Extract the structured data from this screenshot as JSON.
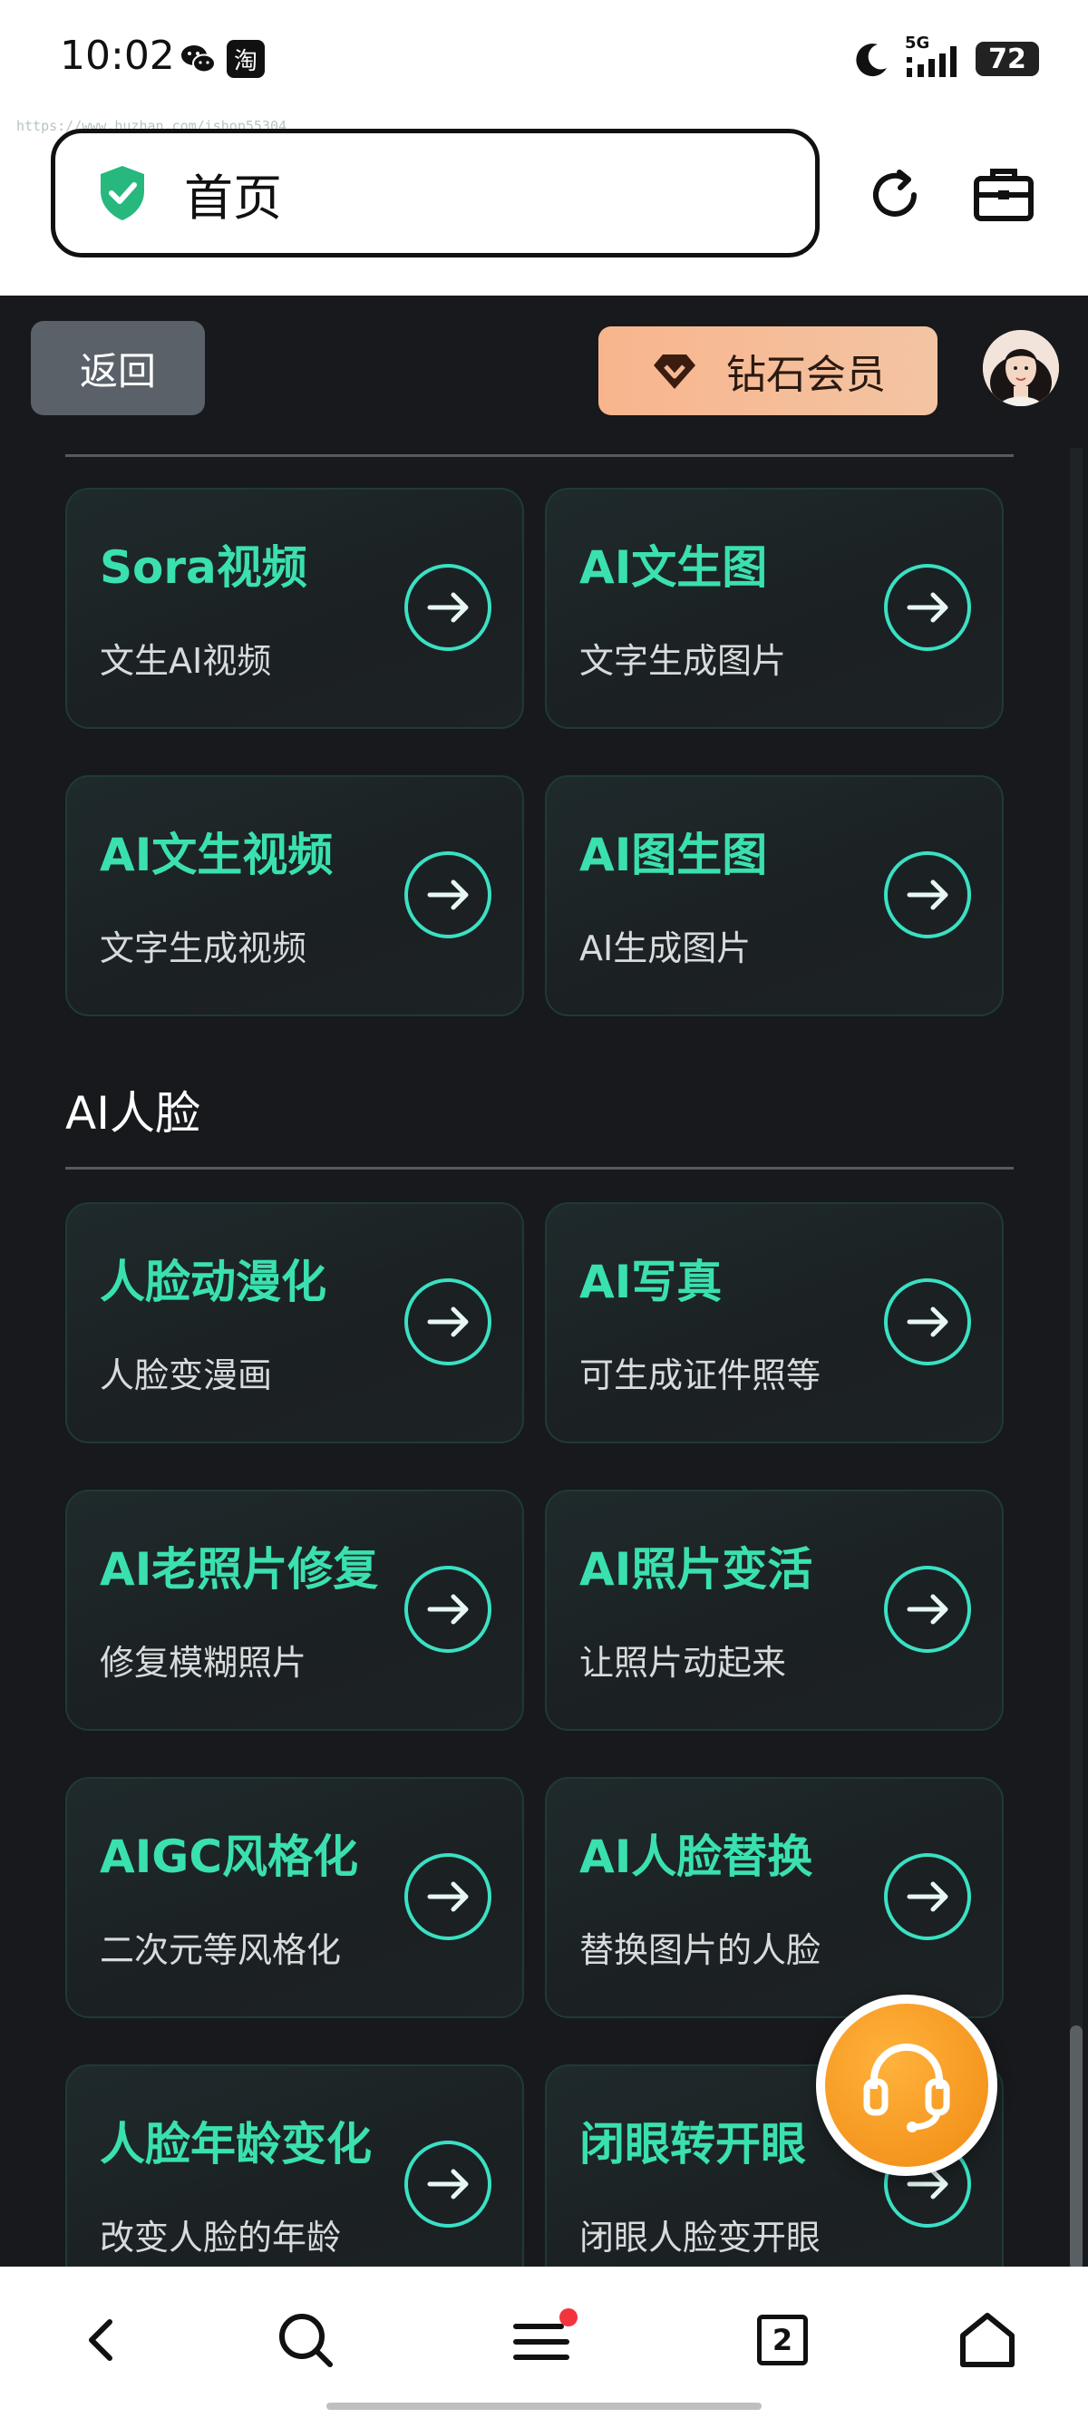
{
  "status_bar": {
    "time": "10:02",
    "wechat_icon": "wechat-icon",
    "taobao_label": "淘",
    "network": "5G",
    "battery": "72"
  },
  "watermark_url": "https://www.huzhan.com/ishop55304",
  "address_bar": {
    "title": "首页",
    "secure_icon": "shield-check-icon"
  },
  "header": {
    "back_label": "返回",
    "vip_label": "钻石会员"
  },
  "sections": [
    {
      "title": "",
      "cards": [
        {
          "title": "Sora视频",
          "subtitle": "文生AI视频"
        },
        {
          "title": "AI文生图",
          "subtitle": "文字生成图片"
        },
        {
          "title": "AI文生视频",
          "subtitle": "文字生成视频"
        },
        {
          "title": "AI图生图",
          "subtitle": "AI生成图片"
        }
      ]
    },
    {
      "title": "AI人脸",
      "cards": [
        {
          "title": "人脸动漫化",
          "subtitle": "人脸变漫画"
        },
        {
          "title": "AI写真",
          "subtitle": "可生成证件照等"
        },
        {
          "title": "AI老照片修复",
          "subtitle": "修复模糊照片"
        },
        {
          "title": "AI照片变活",
          "subtitle": "让照片动起来"
        },
        {
          "title": "AIGC风格化",
          "subtitle": "二次元等风格化"
        },
        {
          "title": "AI人脸替换",
          "subtitle": "替换图片的人脸"
        },
        {
          "title": "人脸年龄变化",
          "subtitle": "改变人脸的年龄"
        },
        {
          "title": "闭眼转开眼",
          "subtitle": "闭眼人脸变开眼"
        }
      ]
    }
  ],
  "bottom_nav": {
    "tab_count": "2"
  },
  "colors": {
    "accent": "#3ae0b0",
    "page_bg": "#17191c",
    "vip_bg": "#f8b58d"
  }
}
